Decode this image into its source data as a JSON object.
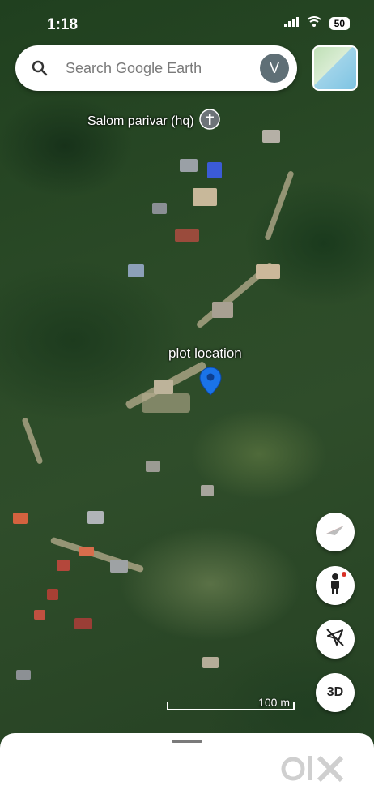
{
  "status_bar": {
    "time": "1:18",
    "battery": "50"
  },
  "search": {
    "placeholder": "Search Google Earth",
    "avatar_initial": "V"
  },
  "map": {
    "place_label": "Salom parivar (hq)",
    "pin_label": "plot location",
    "pin_color": "#1a73e8",
    "scale_label": "100 m"
  },
  "controls": {
    "three_d_label": "3D"
  },
  "watermark": {
    "text": "OLX"
  }
}
